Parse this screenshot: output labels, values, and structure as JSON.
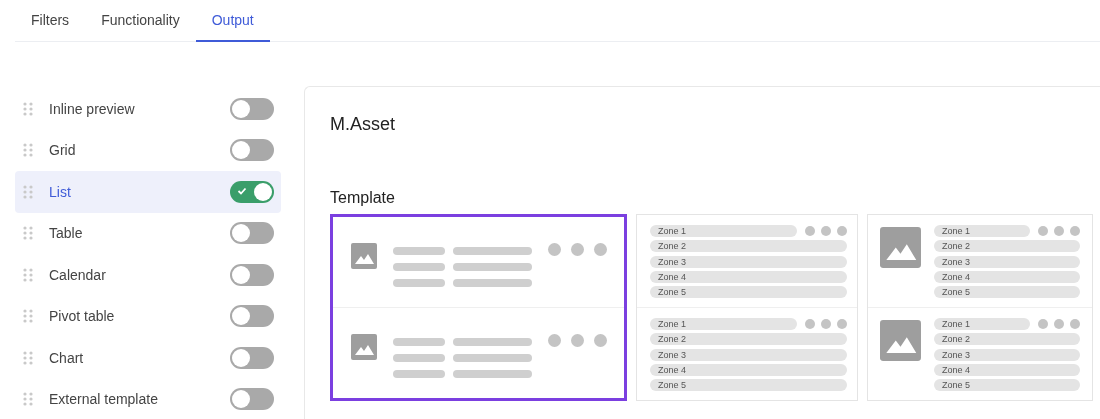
{
  "tabs": [
    {
      "label": "Filters",
      "selected": false
    },
    {
      "label": "Functionality",
      "selected": false
    },
    {
      "label": "Output",
      "selected": true
    }
  ],
  "views": [
    {
      "label": "Inline preview",
      "selected": false,
      "on": false
    },
    {
      "label": "Grid",
      "selected": false,
      "on": false
    },
    {
      "label": "List",
      "selected": true,
      "on": true
    },
    {
      "label": "Table",
      "selected": false,
      "on": false
    },
    {
      "label": "Calendar",
      "selected": false,
      "on": false
    },
    {
      "label": "Pivot table",
      "selected": false,
      "on": false
    },
    {
      "label": "Chart",
      "selected": false,
      "on": false
    },
    {
      "label": "External template",
      "selected": false,
      "on": false
    }
  ],
  "panel": {
    "title": "M.Asset",
    "section": "Template",
    "templates": [
      {
        "kind": "lines",
        "selected": true
      },
      {
        "kind": "zones",
        "selected": false,
        "rows": [
          {
            "zones": [
              "Zone 1",
              "Zone 2",
              "Zone 3",
              "Zone 4",
              "Zone 5"
            ]
          },
          {
            "zones": [
              "Zone 1",
              "Zone 2",
              "Zone 3",
              "Zone 4",
              "Zone 5"
            ]
          }
        ]
      },
      {
        "kind": "image-zones",
        "selected": false,
        "rows": [
          {
            "zones": [
              "Zone 1",
              "Zone 2",
              "Zone 3",
              "Zone 4",
              "Zone 5"
            ]
          },
          {
            "zones": [
              "Zone 1",
              "Zone 2",
              "Zone 3",
              "Zone 4",
              "Zone 5"
            ]
          }
        ]
      }
    ]
  }
}
